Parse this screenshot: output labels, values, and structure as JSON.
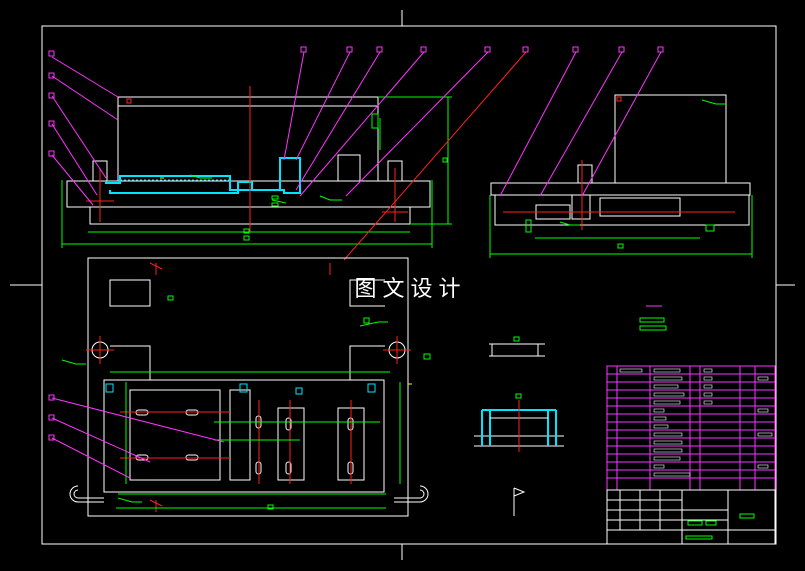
{
  "watermark": "图文设计",
  "colors": {
    "background": "#000000",
    "frame": "#ffffff",
    "dimension": "#00ff00",
    "leader": "#ff33ff",
    "centerline": "#ff2020",
    "section": "#00e5ff",
    "outline": "#ffffff",
    "accent": "#ffff00"
  },
  "drawing": {
    "views": [
      "front-view",
      "side-view",
      "top-view",
      "detail-section",
      "detail-profile"
    ],
    "title_block": {
      "rows": 15,
      "columns": 6
    }
  }
}
